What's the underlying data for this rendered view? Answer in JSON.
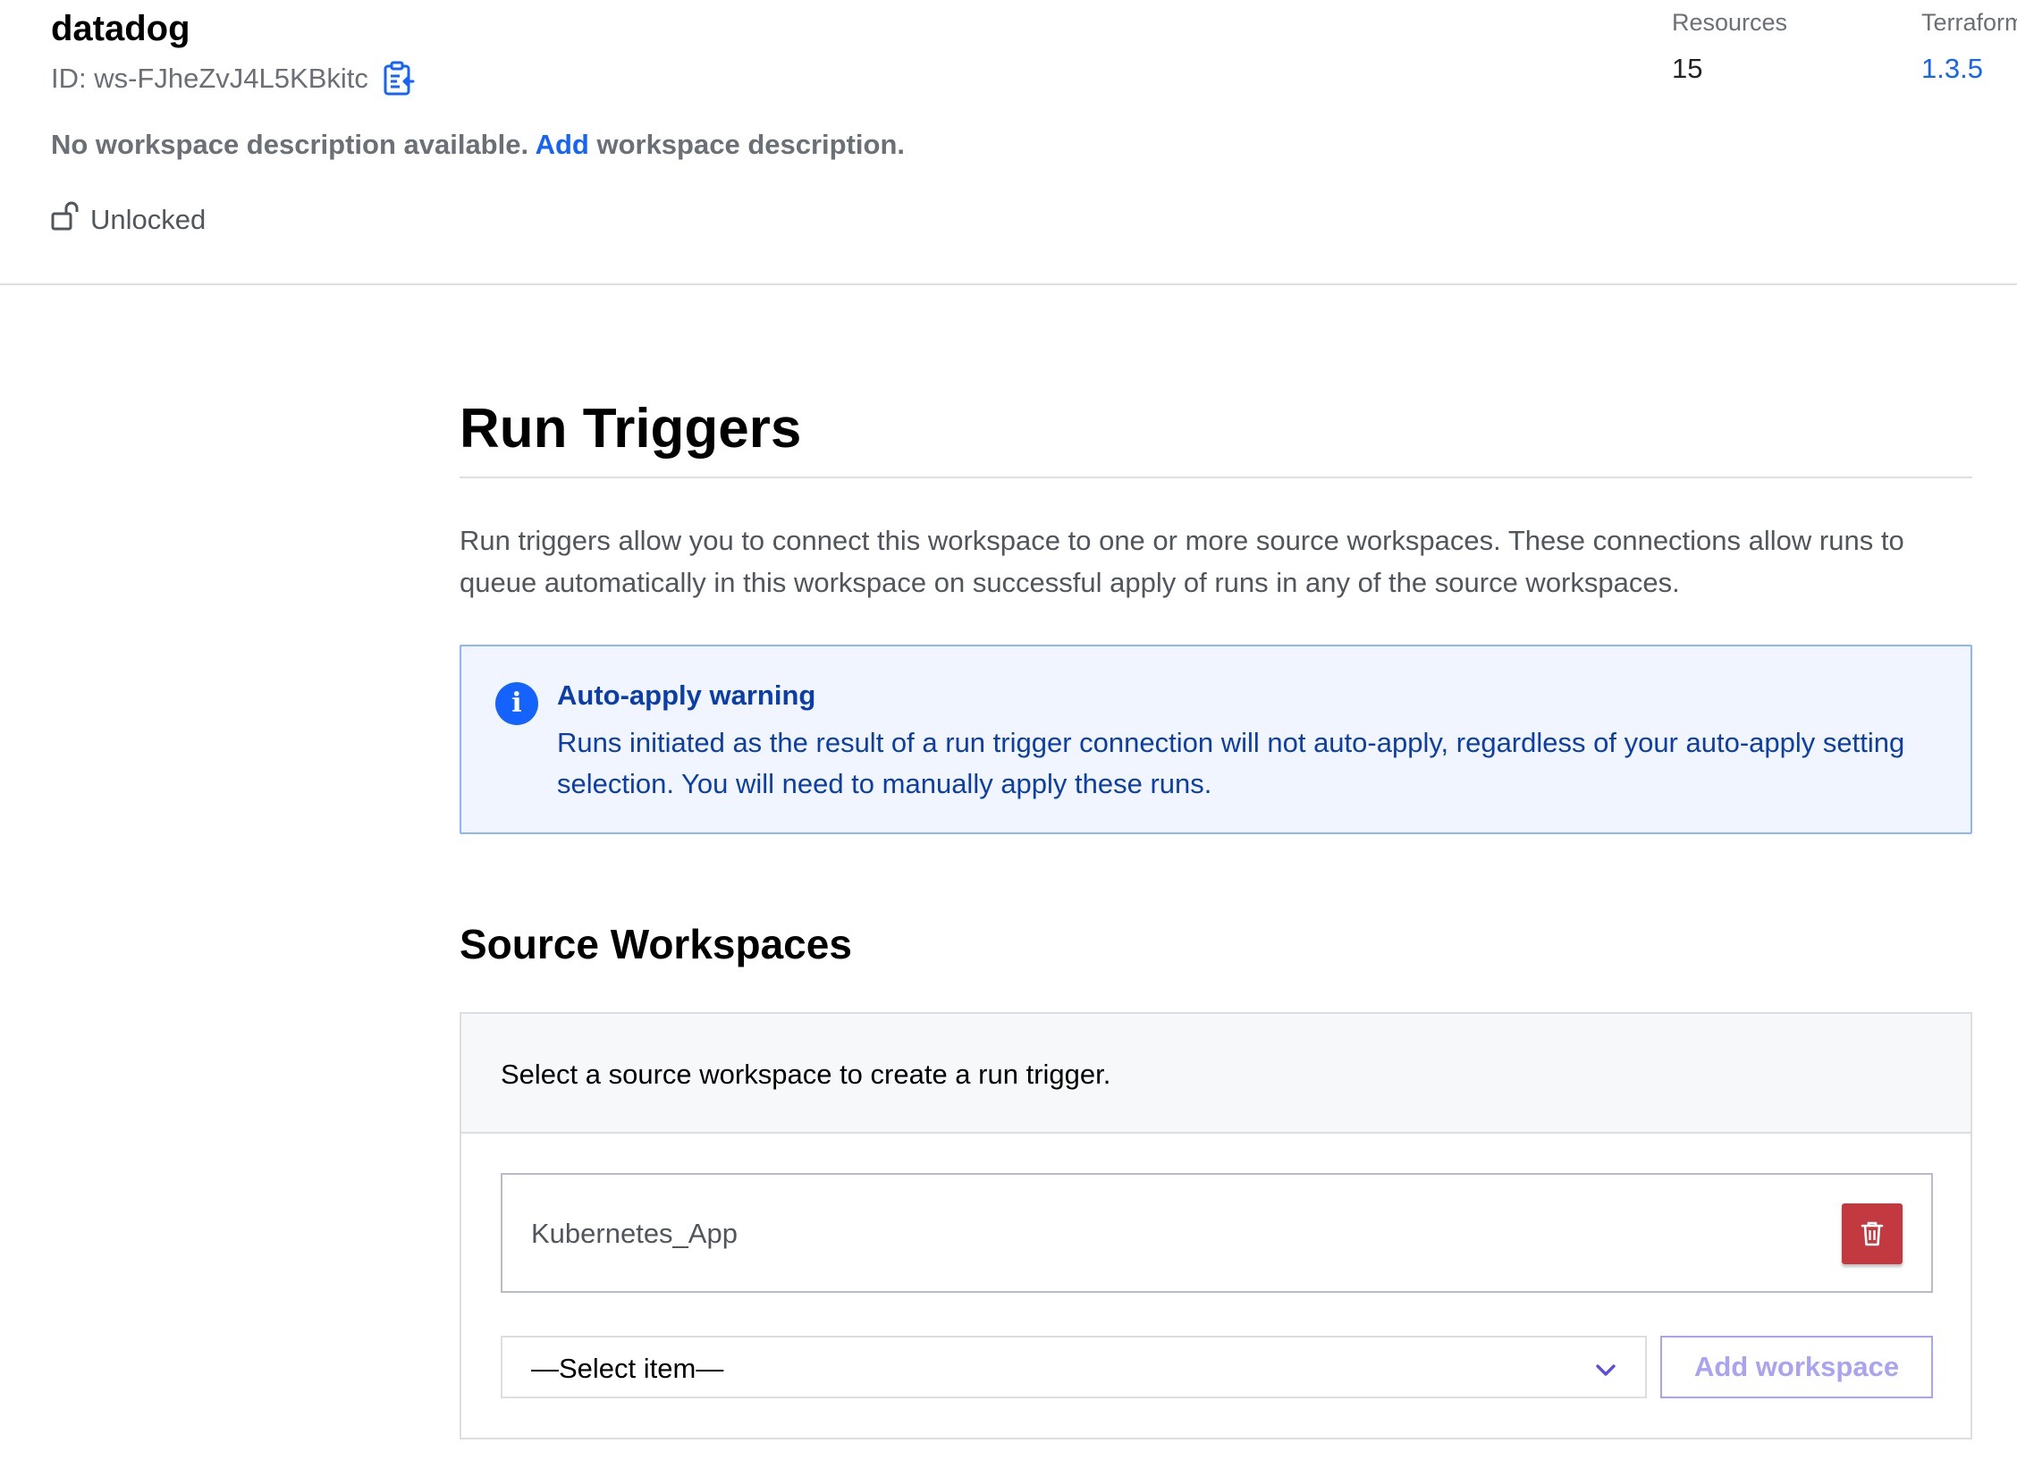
{
  "workspace": {
    "name": "datadog",
    "id_label": "ID: ws-FJheZvJ4L5KBkitc",
    "description_prefix": "No workspace description available.",
    "description_link": "Add",
    "description_suffix": "workspace description.",
    "lock_status": "Unlocked"
  },
  "stats": {
    "resources_label": "Resources",
    "resources_value": "15",
    "terraform_label": "Terraform",
    "terraform_value": "1.3.5"
  },
  "main": {
    "title": "Run Triggers",
    "intro": "Run triggers allow you to connect this workspace to one or more source workspaces. These connections allow runs to queue automatically in this workspace on successful apply of runs in any of the source workspaces.",
    "notice": {
      "title": "Auto-apply warning",
      "body": "Runs initiated as the result of a run trigger connection will not auto-apply, regardless of your auto-apply setting selection. You will need to manually apply these runs.",
      "icon": "info-icon"
    },
    "source_section": {
      "title": "Source Workspaces",
      "panel_text": "Select a source workspace to create a run trigger.",
      "workspaces": [
        {
          "name": "Kubernetes_App"
        }
      ],
      "select_placeholder": "—Select item—",
      "add_button": "Add workspace"
    }
  },
  "colors": {
    "link": "#1563ff",
    "notice_bg": "#f0f5ff",
    "notice_border": "#8cb4ff",
    "notice_text": "#0c3dac",
    "danger": "#c23a3f",
    "add_button": "#a9a3f5"
  }
}
